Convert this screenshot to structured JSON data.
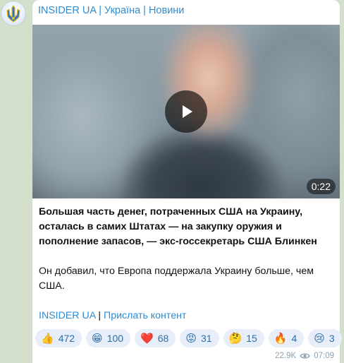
{
  "channel": {
    "name": "INSIDER UA | Україна | Новини",
    "avatar_icon": "ukraine-trident-icon"
  },
  "video": {
    "duration": "0:22",
    "play_icon": "play-icon"
  },
  "post": {
    "paragraph1": "Большая часть денег, потраченных США на Украину, осталась в самих Штатах — на закупку оружия и пополнение запасов, — экс-госсекретарь США Блинкен",
    "paragraph2": "Он добавил, что Европа поддержала Украину больше, чем США."
  },
  "footer": {
    "link1": "INSIDER UA",
    "separator": " | ",
    "link2": "Прислать контент"
  },
  "reactions": [
    {
      "emoji": "👍",
      "count": "472",
      "icon": "thumbs-up-icon"
    },
    {
      "emoji": "😁",
      "count": "100",
      "icon": "grin-icon"
    },
    {
      "emoji": "❤️",
      "count": "68",
      "icon": "heart-icon"
    },
    {
      "emoji": "😡",
      "count": "31",
      "icon": "angry-icon"
    },
    {
      "emoji": "🤔",
      "count": "15",
      "icon": "thinking-icon"
    },
    {
      "emoji": "🔥",
      "count": "4",
      "icon": "fire-icon"
    },
    {
      "emoji": "😢",
      "count": "3",
      "icon": "crying-icon"
    }
  ],
  "meta": {
    "views": "22.9K",
    "time": "07:09",
    "eye_icon": "eye-icon"
  },
  "colors": {
    "accent": "#2f8bd0",
    "background": "#d4dfcb",
    "reaction_bg": "#e7eef9"
  }
}
